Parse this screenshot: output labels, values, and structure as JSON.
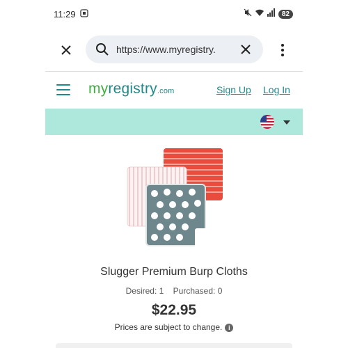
{
  "status_bar": {
    "time": "11:29",
    "battery": "82"
  },
  "browser": {
    "url": "https://www.myregistry."
  },
  "site": {
    "logo_main": "my",
    "logo_reg": "registry",
    "logo_tld": ".com",
    "signup_label": "Sign Up",
    "login_label": "Log In"
  },
  "product": {
    "name": "Slugger Premium Burp Cloths",
    "desired": "Desired: 1",
    "purchased": "Purchased: 0",
    "price": "$22.95",
    "price_note": "Prices are subject to change."
  },
  "colors": {
    "accent": "#1f8a88",
    "band": "#aee8dc",
    "logo_green": "#3fae3f"
  }
}
